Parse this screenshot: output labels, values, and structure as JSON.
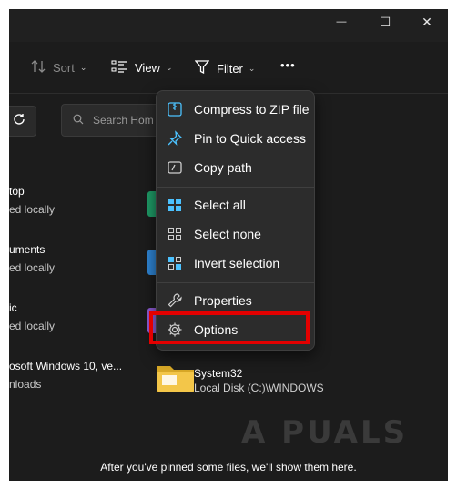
{
  "window": {
    "controls": {
      "minimize": "—",
      "maximize": "☐",
      "close": "✕"
    }
  },
  "toolbar": {
    "sort_label": "Sort",
    "view_label": "View",
    "filter_label": "Filter",
    "more_label": "•••"
  },
  "search": {
    "placeholder": "Search Hom"
  },
  "quick_access": [
    {
      "name": "top",
      "status": "ed locally",
      "folder_color": "#1f9d68"
    },
    {
      "name": "uments",
      "status": "ed locally",
      "folder_color": "#2f86d6"
    },
    {
      "name": "ic",
      "status": "ed locally",
      "folder_color": "#8e5cd6"
    },
    {
      "name": "osoft Windows 10, ve...",
      "status": "nloads"
    }
  ],
  "context_menu": {
    "items": [
      {
        "label": "Compress to ZIP file",
        "icon": "zip-file-icon"
      },
      {
        "label": "Pin to Quick access",
        "icon": "pin-icon"
      },
      {
        "label": "Copy path",
        "icon": "copy-path-icon"
      },
      {
        "label": "Select all",
        "icon": "select-all-icon"
      },
      {
        "label": "Select none",
        "icon": "select-none-icon"
      },
      {
        "label": "Invert selection",
        "icon": "invert-selection-icon"
      },
      {
        "label": "Properties",
        "icon": "wrench-icon"
      },
      {
        "label": "Options",
        "icon": "gear-icon"
      }
    ]
  },
  "system_folder": {
    "name": "System32",
    "path": "Local Disk (C:)\\WINDOWS"
  },
  "empty_message": "After you've pinned some files, we'll show them here.",
  "watermark": "A PUALS",
  "colors": {
    "highlight": "#e30000",
    "accent": "#4cc2ff"
  }
}
